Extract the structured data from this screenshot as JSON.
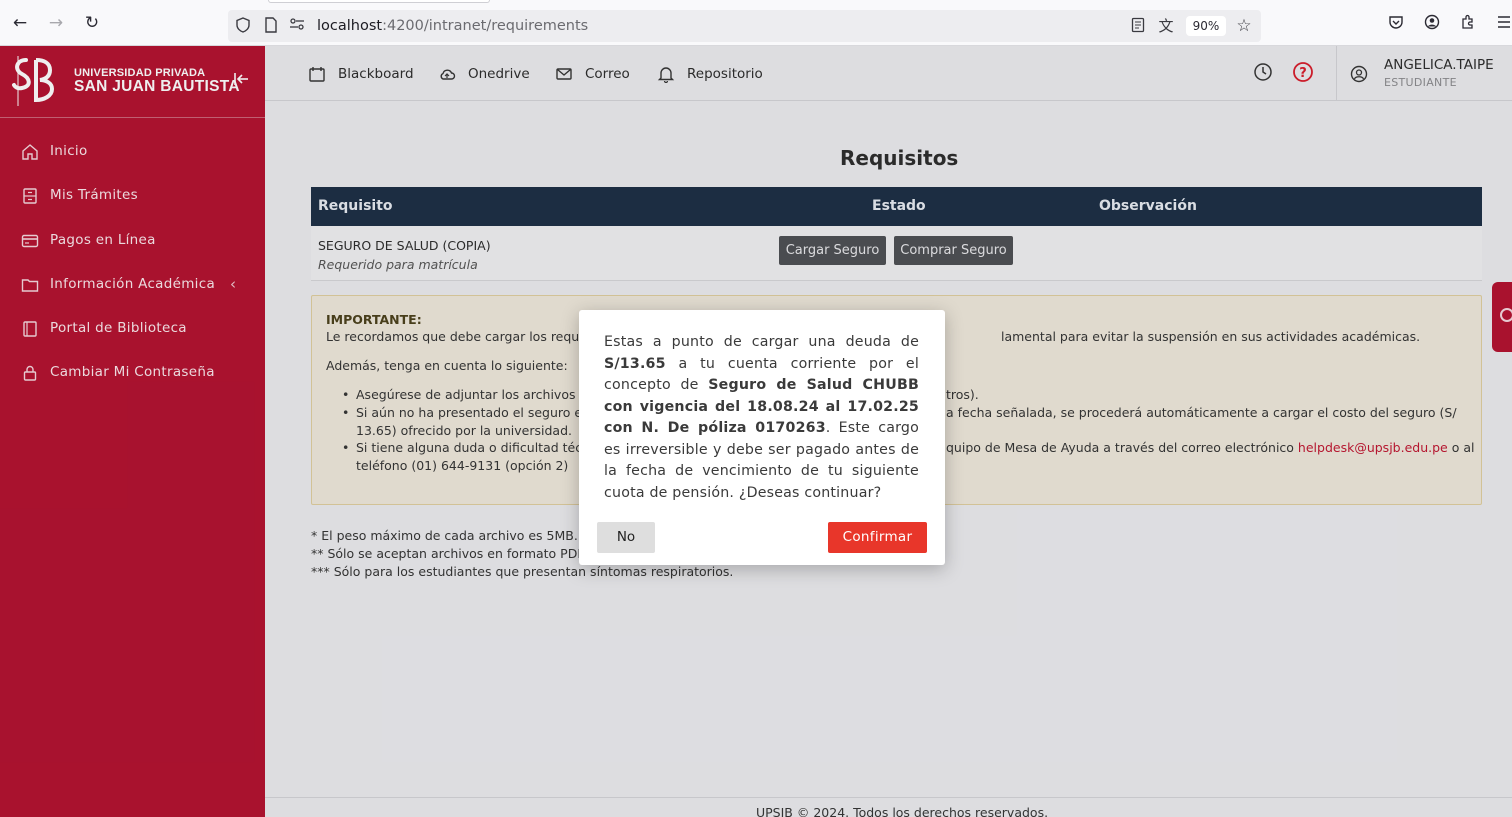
{
  "browser": {
    "url_host": "localhost",
    "url_rest": ":4200/intranet/requirements",
    "zoom": "90%"
  },
  "sidebar": {
    "brand_small": "UNIVERSIDAD PRIVADA",
    "brand_big": "SAN JUAN BAUTISTA",
    "items": [
      {
        "label": "Inicio",
        "icon": "home-icon"
      },
      {
        "label": "Mis Trámites",
        "icon": "documents-icon"
      },
      {
        "label": "Pagos en Línea",
        "icon": "credit-card-icon"
      },
      {
        "label": "Información Académica",
        "icon": "folder-icon"
      },
      {
        "label": "Portal de Biblioteca",
        "icon": "book-icon"
      },
      {
        "label": "Cambiar Mi Contraseña",
        "icon": "lock-icon"
      }
    ]
  },
  "header": {
    "links": [
      {
        "label": "Blackboard",
        "icon": "calendar-icon"
      },
      {
        "label": "Onedrive",
        "icon": "cloud-icon"
      },
      {
        "label": "Correo",
        "icon": "mail-icon"
      },
      {
        "label": "Repositorio",
        "icon": "bell-icon"
      }
    ],
    "user_name": "ANGELICA.TAIPE",
    "user_role": "ESTUDIANTE"
  },
  "main": {
    "title": "Requisitos",
    "table": {
      "headers": [
        "Requisito",
        "Estado",
        "Observación"
      ],
      "rows": [
        {
          "name": "SEGURO DE SALUD (COPIA)",
          "note": "Requerido para matrícula",
          "btn_upload": "Cargar Seguro",
          "btn_buy": "Comprar Seguro"
        }
      ]
    },
    "important": {
      "title": "IMPORTANTE:",
      "line1_a": "Le recordamos que debe cargar los requis",
      "line1_b": "lamental para evitar la suspensión en sus actividades académicas.",
      "line2": "Además, tenga en cuenta lo siguiente:",
      "b1_a": "Asegúrese de adjuntar los archivos re",
      "b1_b": "tros).",
      "b2_a": "Si aún no ha presentado el seguro es",
      "b2_b": "a fecha señalada, se procederá automáticamente a cargar el costo del seguro (S/",
      "b2_c": "13.65) ofrecido por la universidad.",
      "b3_a": "Si tiene alguna duda o dificultad técn",
      "b3_b": "quipo de Mesa de Ayuda a través del correo electrónico ",
      "b3_email": "helpdesk@upsjb.edu.pe",
      "b3_c": " o al",
      "b3_d": "teléfono (01) 644-9131 (opción 2)"
    },
    "notes": [
      "* El peso máximo de cada archivo es 5MB.",
      "** Sólo se aceptan archivos en formato PDF.",
      "*** Sólo para los estudiantes que presentan síntomas respiratorios."
    ],
    "footer": "UPSJB © 2024. Todos los derechos reservados."
  },
  "modal": {
    "t1": "Estas a punto de cargar una deuda de ",
    "amount": "S/13.65",
    "t2": " a tu cuenta corriente por el concepto de ",
    "concept": "Seguro de Salud CHUBB con vigencia del 18.08.24 al 17.02.25 con N. De póliza 0170263",
    "t3": ". Este cargo es irreversible y debe ser pagado antes de la fecha de vencimiento de tu siguiente cuota de pensión. ¿Deseas continuar?",
    "no_label": "No",
    "confirm_label": "Confirmar"
  },
  "colors": {
    "brand_red": "#b3102e",
    "table_header": "#1b2d44",
    "confirm_red": "#e8362a"
  }
}
